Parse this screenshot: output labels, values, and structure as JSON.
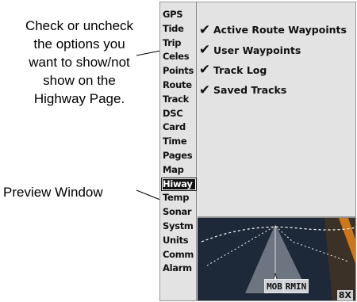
{
  "callouts": {
    "options": [
      "Check or uncheck",
      "the options you",
      "want to show/not",
      "show on the",
      "Highway Page."
    ],
    "preview": "Preview Window"
  },
  "sidebar": {
    "items": [
      {
        "label": "GPS"
      },
      {
        "label": "Tide"
      },
      {
        "label": "Trip"
      },
      {
        "label": "Celes"
      },
      {
        "label": "Points"
      },
      {
        "label": "Route"
      },
      {
        "label": "Track"
      },
      {
        "label": "DSC"
      },
      {
        "label": "Card"
      },
      {
        "label": "Time"
      },
      {
        "label": "Pages"
      },
      {
        "label": "Map"
      },
      {
        "label": "Hiway",
        "active": true
      },
      {
        "label": "Temp"
      },
      {
        "label": "Sonar"
      },
      {
        "label": "Systm"
      },
      {
        "label": "Units"
      },
      {
        "label": "Comm"
      },
      {
        "label": "Alarm"
      }
    ]
  },
  "options": [
    {
      "label": "Active Route Waypoints",
      "checked": true
    },
    {
      "label": "User Waypoints",
      "checked": true
    },
    {
      "label": "Track Log",
      "checked": true
    },
    {
      "label": "Saved Tracks",
      "checked": true
    }
  ],
  "check_glyph": "✔",
  "icons": {
    "checkbox": "checkmark-icon",
    "vessel": "boat-icon"
  },
  "preview": {
    "labels": [
      "MOB",
      "RMIN"
    ],
    "zoom": "8X"
  },
  "colors": {
    "preview_bg": "#1d2838",
    "active_tab_bg": "#111111",
    "accent_orange": "#f08a1c"
  }
}
